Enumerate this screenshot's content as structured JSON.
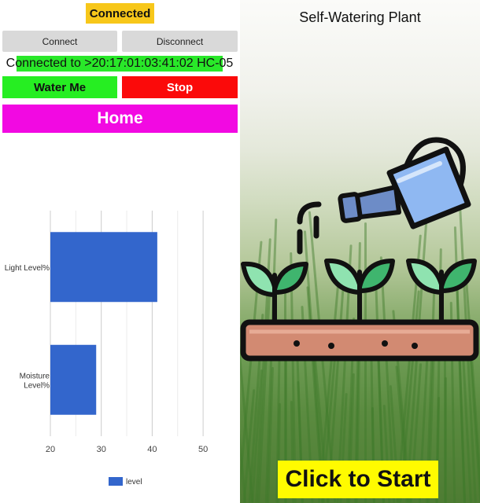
{
  "status": {
    "label": "Connected",
    "color": "#f7c71a"
  },
  "buttons": {
    "connect": "Connect",
    "disconnect": "Disconnect",
    "water": "Water Me",
    "stop": "Stop",
    "home": "Home"
  },
  "connection_info": "Connected to >20:17:01:03:41:02 HC-05",
  "colors": {
    "water": "#26ee22",
    "stop": "#fb0a0a",
    "home": "#f209e2",
    "bar": "#3366cc",
    "start": "#fffb00"
  },
  "chart_data": {
    "type": "bar",
    "orientation": "horizontal",
    "categories": [
      "Light Level%",
      "Moisture Level%"
    ],
    "series": [
      {
        "name": "level",
        "values": [
          41,
          29
        ]
      }
    ],
    "xticks": [
      20,
      30,
      40,
      50
    ],
    "xlim": [
      20,
      54
    ],
    "grid": true,
    "legend_position": "bottom"
  },
  "right_panel": {
    "title": "Self-Watering Plant",
    "start_label": "Click to Start",
    "icon": "watering-can-plants-icon"
  }
}
